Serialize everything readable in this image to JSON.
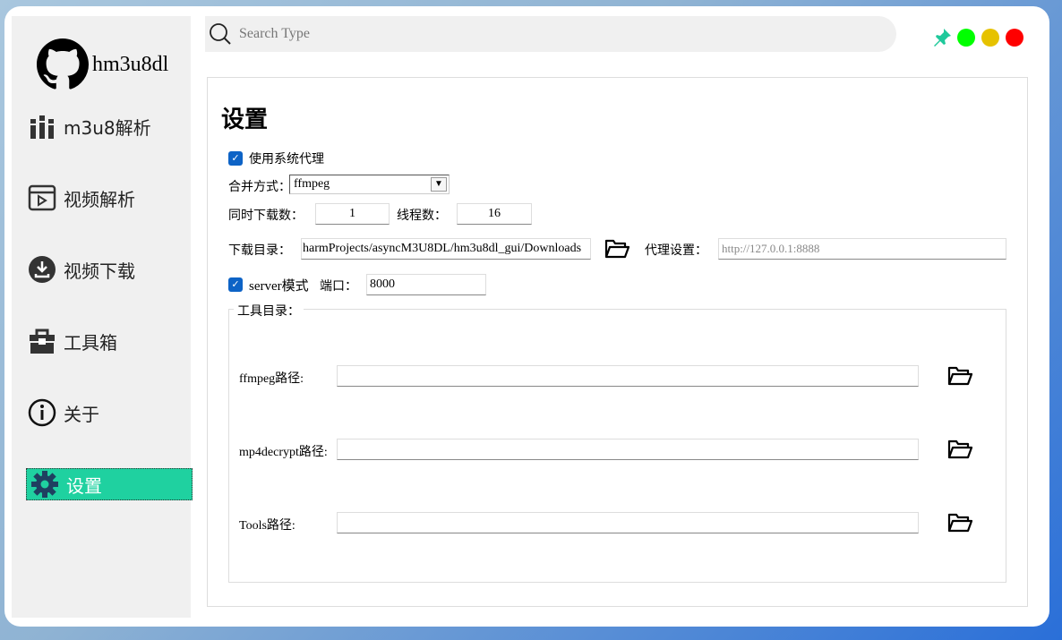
{
  "app": {
    "name": "hm3u8dl"
  },
  "sidebar": {
    "items": [
      {
        "label": "m3u8解析",
        "icon": "books-icon"
      },
      {
        "label": "视频解析",
        "icon": "video-clapper-icon"
      },
      {
        "label": "视频下载",
        "icon": "download-icon"
      },
      {
        "label": "工具箱",
        "icon": "toolbox-icon"
      },
      {
        "label": "关于",
        "icon": "info-icon"
      },
      {
        "label": "设置",
        "icon": "gear-icon",
        "active": true
      }
    ]
  },
  "search": {
    "placeholder": "Search Type"
  },
  "window_controls": {
    "colors": {
      "pin": "#1fc99b",
      "green": "#00ff00",
      "yellow": "#e6c200",
      "red": "#ff0000"
    }
  },
  "settings": {
    "title": "设置",
    "use_system_proxy": {
      "label": "使用系统代理",
      "checked": true
    },
    "merge_mode": {
      "label": "合并方式：",
      "value": "ffmpeg"
    },
    "concurrent_downloads": {
      "label": "同时下载数：",
      "value": "1"
    },
    "threads": {
      "label": "线程数：",
      "value": "16"
    },
    "download_dir": {
      "label": "下载目录：",
      "value": "harmProjects/asyncM3U8DL/hm3u8dl_gui/Downloads"
    },
    "proxy": {
      "label": "代理设置：",
      "placeholder": "http://127.0.0.1:8888"
    },
    "server_mode": {
      "label": "server模式",
      "checked": true
    },
    "port": {
      "label": "端口：",
      "value": "8000"
    },
    "tools": {
      "label": "工具目录：",
      "rows": [
        {
          "label": "ffmpeg路径:",
          "value": ""
        },
        {
          "label": "mp4decrypt路径:",
          "value": ""
        },
        {
          "label": "Tools路径:",
          "value": ""
        }
      ]
    }
  }
}
